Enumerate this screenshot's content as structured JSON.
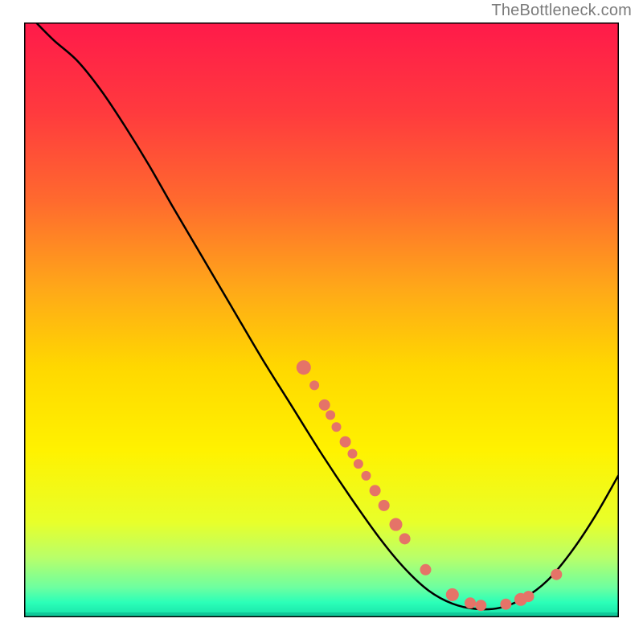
{
  "attribution": "TheBottleneck.com",
  "chart_data": {
    "type": "line",
    "title": "",
    "xlabel": "",
    "ylabel": "",
    "xlim": [
      0,
      100
    ],
    "ylim": [
      0,
      100
    ],
    "background_gradient": [
      {
        "stop": 0.0,
        "color": "#ff1a4a"
      },
      {
        "stop": 0.15,
        "color": "#ff3a3e"
      },
      {
        "stop": 0.3,
        "color": "#ff6a2e"
      },
      {
        "stop": 0.45,
        "color": "#ffa918"
      },
      {
        "stop": 0.58,
        "color": "#ffd800"
      },
      {
        "stop": 0.72,
        "color": "#fff200"
      },
      {
        "stop": 0.84,
        "color": "#e8ff2a"
      },
      {
        "stop": 0.9,
        "color": "#b8ff6a"
      },
      {
        "stop": 0.95,
        "color": "#6dffa0"
      },
      {
        "stop": 0.975,
        "color": "#2bffb8"
      },
      {
        "stop": 1.0,
        "color": "#16e0a8"
      }
    ],
    "series": [
      {
        "name": "curve",
        "stroke": "#000000",
        "stroke_width": 2.5,
        "points": [
          {
            "x": 2.0,
            "y": 100.0
          },
          {
            "x": 5.0,
            "y": 97.0
          },
          {
            "x": 9.0,
            "y": 93.5
          },
          {
            "x": 13.0,
            "y": 88.5
          },
          {
            "x": 17.0,
            "y": 82.5
          },
          {
            "x": 21.0,
            "y": 76.0
          },
          {
            "x": 25.0,
            "y": 69.0
          },
          {
            "x": 30.0,
            "y": 60.5
          },
          {
            "x": 35.0,
            "y": 52.0
          },
          {
            "x": 40.0,
            "y": 43.5
          },
          {
            "x": 45.0,
            "y": 35.5
          },
          {
            "x": 50.0,
            "y": 27.5
          },
          {
            "x": 55.0,
            "y": 20.0
          },
          {
            "x": 60.0,
            "y": 13.0
          },
          {
            "x": 64.0,
            "y": 8.2
          },
          {
            "x": 68.0,
            "y": 4.5
          },
          {
            "x": 72.0,
            "y": 2.3
          },
          {
            "x": 76.0,
            "y": 1.4
          },
          {
            "x": 80.0,
            "y": 1.6
          },
          {
            "x": 84.0,
            "y": 3.2
          },
          {
            "x": 88.0,
            "y": 6.2
          },
          {
            "x": 92.0,
            "y": 11.0
          },
          {
            "x": 96.0,
            "y": 17.0
          },
          {
            "x": 100.0,
            "y": 24.0
          }
        ]
      }
    ],
    "markers": {
      "name": "highlighted-points",
      "fill": "#e57368",
      "radius": 7,
      "points": [
        {
          "x": 47.0,
          "y": 42.0,
          "r": 9
        },
        {
          "x": 48.8,
          "y": 39.0,
          "r": 6
        },
        {
          "x": 50.5,
          "y": 35.7,
          "r": 7
        },
        {
          "x": 51.5,
          "y": 34.0,
          "r": 6
        },
        {
          "x": 52.5,
          "y": 32.0,
          "r": 6
        },
        {
          "x": 54.0,
          "y": 29.5,
          "r": 7
        },
        {
          "x": 55.2,
          "y": 27.5,
          "r": 6
        },
        {
          "x": 56.2,
          "y": 25.8,
          "r": 6
        },
        {
          "x": 57.5,
          "y": 23.8,
          "r": 6
        },
        {
          "x": 59.0,
          "y": 21.3,
          "r": 7
        },
        {
          "x": 60.5,
          "y": 18.8,
          "r": 7
        },
        {
          "x": 62.5,
          "y": 15.6,
          "r": 8
        },
        {
          "x": 64.0,
          "y": 13.2,
          "r": 7
        },
        {
          "x": 67.5,
          "y": 8.0,
          "r": 7
        },
        {
          "x": 72.0,
          "y": 3.8,
          "r": 8
        },
        {
          "x": 75.0,
          "y": 2.4,
          "r": 7
        },
        {
          "x": 76.8,
          "y": 2.0,
          "r": 7
        },
        {
          "x": 81.0,
          "y": 2.2,
          "r": 7
        },
        {
          "x": 83.5,
          "y": 3.0,
          "r": 8
        },
        {
          "x": 84.8,
          "y": 3.5,
          "r": 7
        },
        {
          "x": 89.5,
          "y": 7.2,
          "r": 7
        }
      ]
    }
  }
}
